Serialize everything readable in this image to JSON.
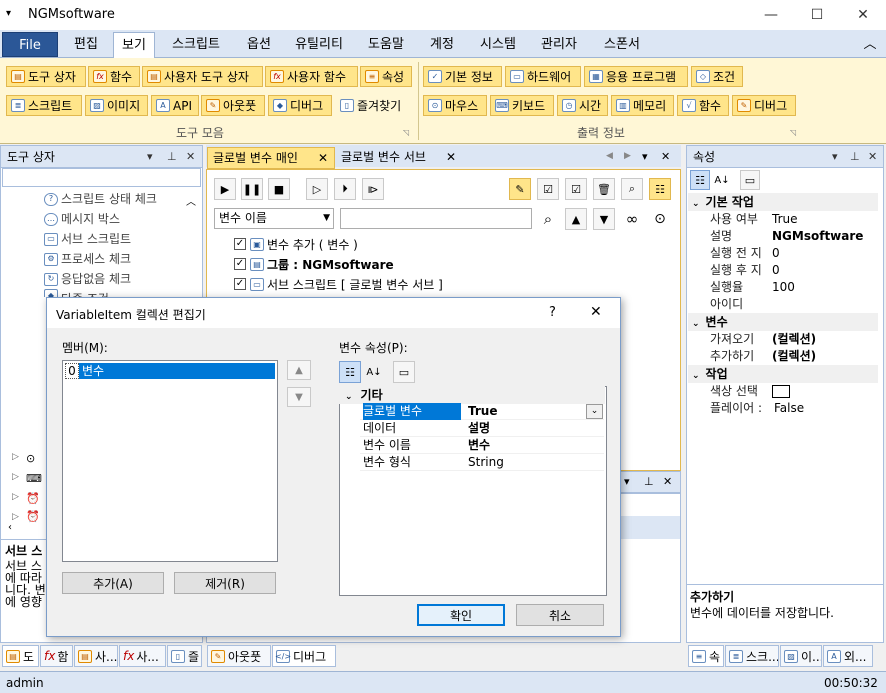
{
  "window": {
    "title": "NGMsoftware",
    "minimize": "—",
    "maximize": "☐",
    "close": "✕",
    "sysmenu": "▾"
  },
  "menu": {
    "file": "File",
    "tabs": [
      "편집",
      "보기",
      "스크립트",
      "옵션",
      "유틸리티",
      "도움말",
      "계정",
      "시스템",
      "관리자",
      "스폰서"
    ],
    "collapse": "︿"
  },
  "ribbon": {
    "group1": {
      "label": "도구 모음",
      "row1": [
        "도구 상자",
        "함수",
        "사용자 도구 상자",
        "사용자 함수",
        "속성"
      ],
      "row2": [
        "스크립트",
        "이미지",
        "API",
        "아웃풋",
        "디버그",
        "즐겨찾기"
      ]
    },
    "group2": {
      "label": "출력 정보",
      "row1": [
        "기본 정보",
        "하드웨어",
        "응용 프로그램",
        "조건"
      ],
      "row2": [
        "마우스",
        "키보드",
        "시간",
        "메모리",
        "함수",
        "디버그"
      ]
    }
  },
  "toolbox": {
    "title": "도구 상자",
    "items": [
      "스크립트 상태 체크",
      "메시지 박스",
      "서브 스크립트",
      "프로세스 체크",
      "응답없음 체크",
      "다중 조건"
    ],
    "desc_title": "서브 스",
    "desc_lines": [
      "서브 스",
      "에 따라",
      "니다. 변",
      "에 영향"
    ]
  },
  "doc": {
    "tabs": [
      "글로벌 변수 매인",
      "글로벌 변수 서브"
    ],
    "combo": "변수 이름",
    "search": "",
    "list": [
      {
        "text": "변수 추가 ( 변수 )",
        "bold": false
      },
      {
        "text": "그룹 : NGMsoftware",
        "bold": true
      },
      {
        "text": "서브 스크립트 [ 글로벌 변수 서브 ]",
        "bold": false
      }
    ]
  },
  "props": {
    "title": "속성",
    "cats": [
      {
        "name": "기본 작업",
        "rows": [
          [
            "사용 여부",
            "True",
            false
          ],
          [
            "설명",
            "NGMsoftware",
            true
          ],
          [
            "실행 전 지",
            "0",
            false
          ],
          [
            "실행 후 지",
            "0",
            false
          ],
          [
            "실행율",
            "100",
            false
          ],
          [
            "아이디",
            "",
            false
          ]
        ]
      },
      {
        "name": "변수",
        "rows": [
          [
            "가져오기",
            "(컬렉션)",
            true
          ],
          [
            "추가하기",
            "(컬렉션)",
            true
          ]
        ]
      },
      {
        "name": "작업",
        "rows": [
          [
            "색상 선택",
            "",
            false
          ],
          [
            "플레이어 :",
            "False",
            false
          ]
        ]
      }
    ],
    "help_title": "추가하기",
    "help_text": "변수에 데이터를 저장합니다."
  },
  "dialog": {
    "title": "VariableItem 컬렉션 편집기",
    "help": "?",
    "close": "✕",
    "members_label": "멤버(M):",
    "member_index": "0",
    "member_name": "변수",
    "props_label": "변수 속성(P):",
    "category": "기타",
    "rows": [
      [
        "글로벌 변수",
        "True"
      ],
      [
        "데이터",
        "설명"
      ],
      [
        "변수 이름",
        "변수"
      ],
      [
        "변수 형식",
        "String"
      ]
    ],
    "add": "추가(A)",
    "remove": "제거(R)",
    "ok": "확인",
    "cancel": "취소"
  },
  "bottom_tabs": [
    "도",
    "함",
    "사...",
    "사...",
    "즐",
    "아웃풋",
    "디버그",
    "속",
    "스크...",
    "이...",
    "외..."
  ],
  "status": {
    "user": "admin",
    "time": "00:50:32"
  }
}
